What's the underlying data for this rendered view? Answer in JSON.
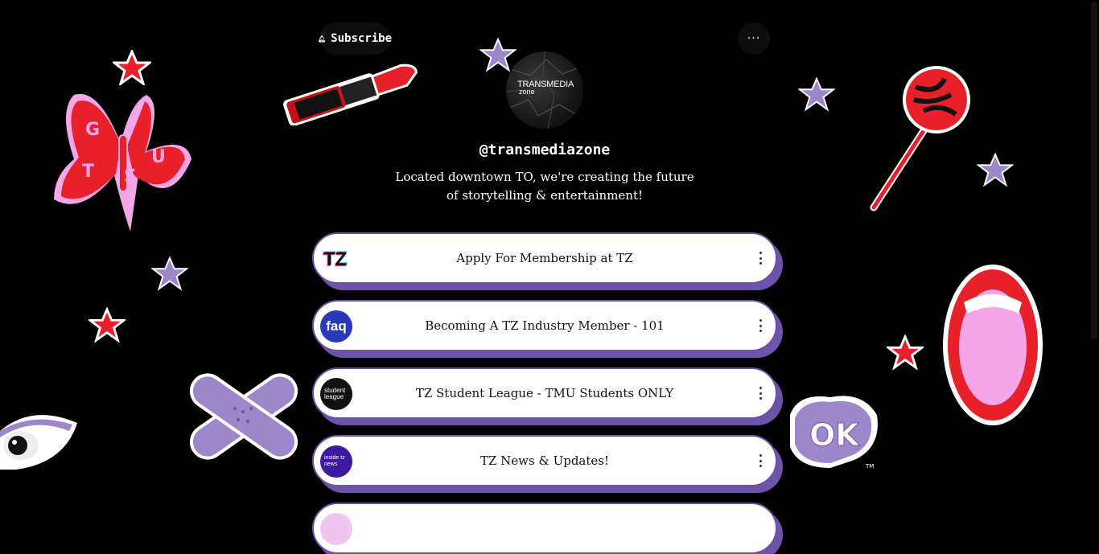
{
  "header": {
    "subscribe_label": "Subscribe",
    "bell_icon": "bell-icon",
    "more_label": "···"
  },
  "profile": {
    "avatar_line1": "TRANSMEDIA",
    "avatar_line2": "zone",
    "handle": "@transmediazone",
    "bio": "Located downtown TO, we're creating the future of storytelling & entertainment!"
  },
  "links": [
    {
      "label": "Apply For Membership at TZ",
      "thumb_text": "TZ",
      "icon": "tz-logo-icon"
    },
    {
      "label": "Becoming A TZ Industry Member - 101",
      "thumb_text": "faq",
      "icon": "faq-icon"
    },
    {
      "label": "TZ Student League - TMU Students ONLY",
      "thumb_text": "student league",
      "icon": "student-league-icon"
    },
    {
      "label": "TZ News & Updates!",
      "thumb_text": "inside tz news",
      "icon": "inside-tz-news-icon"
    },
    {
      "label": "",
      "thumb_text": "",
      "icon": "partial-link-icon"
    }
  ],
  "stickers": {
    "butterfly_letters": [
      "G",
      "T",
      "S",
      "U"
    ],
    "bubble_text": "OK",
    "tm_mark": "TM"
  },
  "colors": {
    "background": "#000000",
    "card_border": "#6c4fa8",
    "card_shadow": "#6c55a8",
    "sticker_red": "#e8202a",
    "sticker_purple": "#9b87c9",
    "sticker_pink": "#f5a6e8"
  }
}
